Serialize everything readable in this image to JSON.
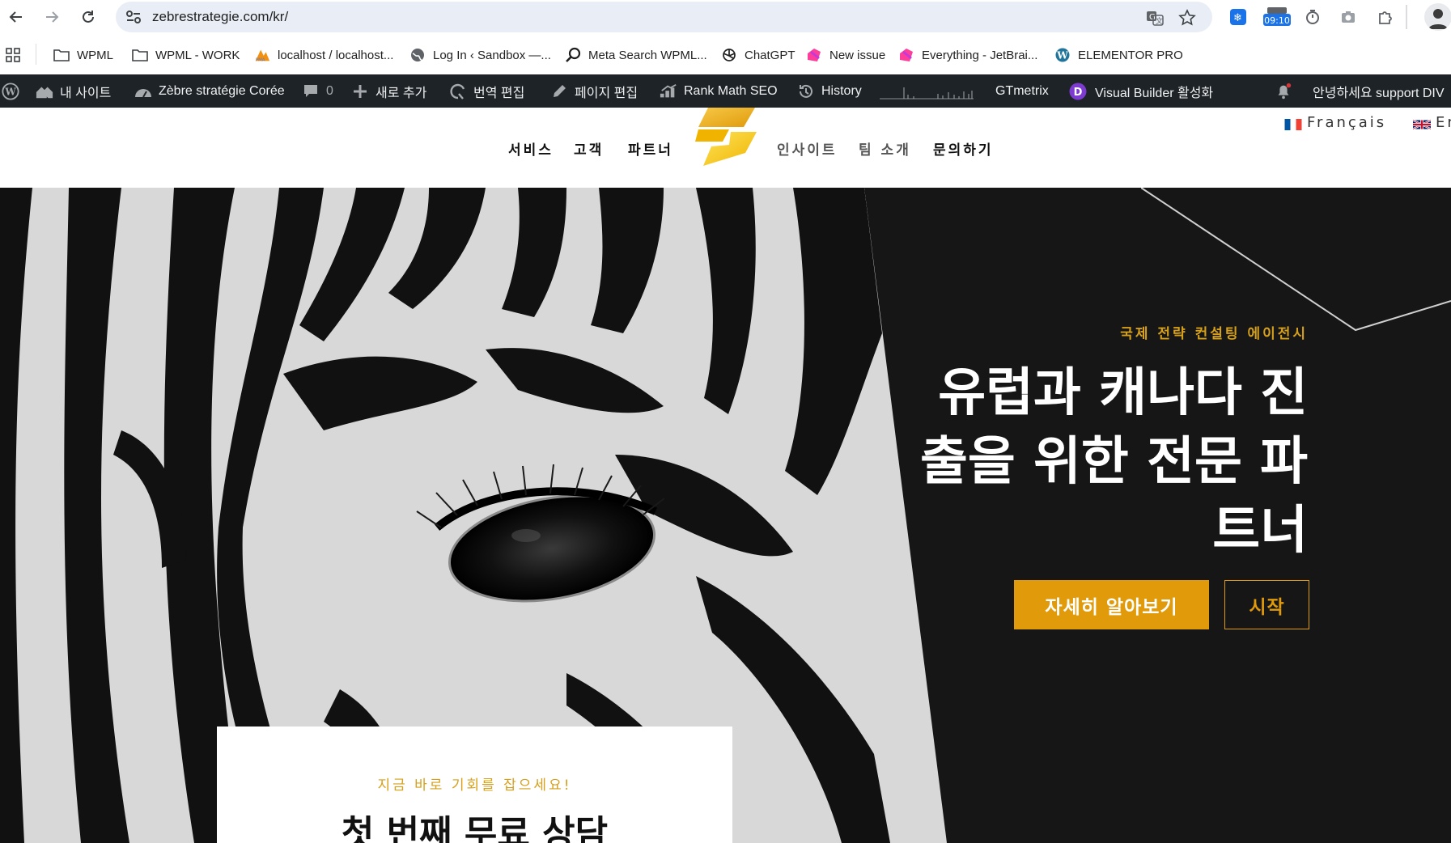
{
  "browser": {
    "url": "zebrestrategie.com/kr/",
    "clock": "09:10"
  },
  "bookmarks": [
    {
      "label": "WPML",
      "icon": "folder-icon"
    },
    {
      "label": "WPML - WORK",
      "icon": "folder-icon"
    },
    {
      "label": "localhost / localhost...",
      "icon": "phpmyadmin-icon"
    },
    {
      "label": "Log In ‹ Sandbox —...",
      "icon": "globe-icon"
    },
    {
      "label": "Meta Search WPML...",
      "icon": "magnifier-icon"
    },
    {
      "label": "ChatGPT",
      "icon": "openai-icon"
    },
    {
      "label": "New issue",
      "icon": "jetbrains-icon"
    },
    {
      "label": "Everything - JetBrai...",
      "icon": "jetbrains-icon"
    },
    {
      "label": "ELEMENTOR PRO",
      "icon": "wordpress-icon"
    }
  ],
  "adminbar": {
    "my_sites": "내 사이트",
    "site_name": "Zèbre stratégie Corée",
    "comments_count": "0",
    "new": "새로 추가",
    "translate": "번역 편집",
    "edit_page": "페이지 편집",
    "rank_math": "Rank Math SEO",
    "history": "History",
    "gtmetrix": "GTmetrix",
    "visual_builder": "Visual Builder 활성화",
    "greeting": "안녕하세요 support DIV"
  },
  "header": {
    "menu_left": [
      "서비스",
      "고객",
      "파트너"
    ],
    "menu_right": [
      "인사이트",
      "팀 소개",
      "문의하기"
    ],
    "lang_fr": "Français",
    "lang_en": "En"
  },
  "hero": {
    "eyebrow": "국제 전략 컨설팅 에이전시",
    "title_lines": [
      "유럽과 캐나다 진",
      "출을 위한 전문 파",
      "트너"
    ],
    "primary_button": "자세히 알아보기",
    "secondary_button": "시작"
  },
  "promo": {
    "eyebrow": "지금 바로 기회를 잡으세요!",
    "title": "첫 번째 무료 상담"
  },
  "colors": {
    "accent": "#e09a0a",
    "eyebrow": "#d6a01b",
    "adminbar": "#1d2327",
    "hero_bg": "#161616"
  }
}
